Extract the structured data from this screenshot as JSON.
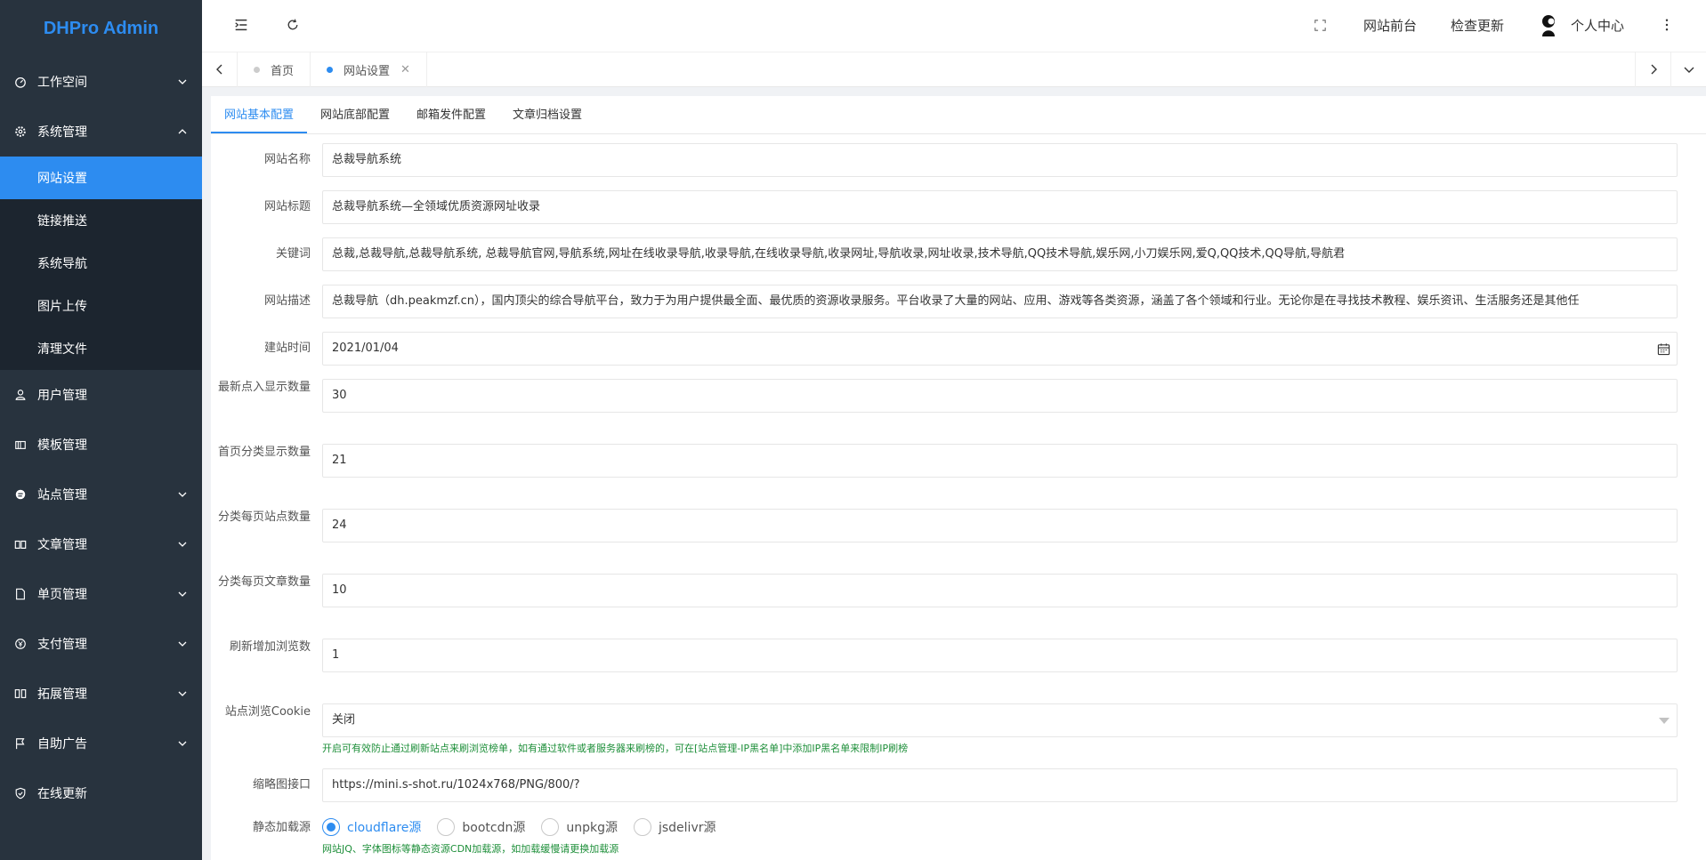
{
  "app": {
    "logo": "DHPro Admin"
  },
  "sidebar": {
    "items": [
      {
        "label": "工作空间",
        "icon": "dashboard-icon",
        "chevron": "down"
      },
      {
        "label": "系统管理",
        "icon": "gear-icon",
        "chevron": "up"
      },
      {
        "label": "用户管理",
        "icon": "user-icon",
        "chevron": ""
      },
      {
        "label": "模板管理",
        "icon": "template-icon",
        "chevron": ""
      },
      {
        "label": "站点管理",
        "icon": "globe-icon",
        "chevron": "down"
      },
      {
        "label": "文章管理",
        "icon": "book-icon",
        "chevron": "down"
      },
      {
        "label": "单页管理",
        "icon": "file-icon",
        "chevron": "down"
      },
      {
        "label": "支付管理",
        "icon": "pay-icon",
        "chevron": "down"
      },
      {
        "label": "拓展管理",
        "icon": "extension-icon",
        "chevron": "down"
      },
      {
        "label": "自助广告",
        "icon": "flag-icon",
        "chevron": "down"
      },
      {
        "label": "在线更新",
        "icon": "shield-check-icon",
        "chevron": ""
      }
    ],
    "system_sub": [
      "网站设置",
      "链接推送",
      "系统导航",
      "图片上传",
      "清理文件"
    ]
  },
  "header": {
    "frontend": "网站前台",
    "check_update": "检查更新",
    "user": "个人中心"
  },
  "tabs": {
    "home": "首页",
    "settings": "网站设置"
  },
  "subtabs": [
    "网站基本配置",
    "网站底部配置",
    "邮箱发件配置",
    "文章归档设置"
  ],
  "form": {
    "site_name": {
      "label": "网站名称",
      "value": "总裁导航系统"
    },
    "site_title": {
      "label": "网站标题",
      "value": "总裁导航系统—全领域优质资源网址收录"
    },
    "keywords": {
      "label": "关键词",
      "value": "总裁,总裁导航,总裁导航系统, 总裁导航官网,导航系统,网址在线收录导航,收录导航,在线收录导航,收录网址,导航收录,网址收录,技术导航,QQ技术导航,娱乐网,小刀娱乐网,爱Q,QQ技术,QQ导航,导航君"
    },
    "description": {
      "label": "网站描述",
      "value": "总裁导航（dh.peakmzf.cn），国内顶尖的综合导航平台，致力于为用户提供最全面、最优质的资源收录服务。平台收录了大量的网站、应用、游戏等各类资源，涵盖了各个领域和行业。无论你是在寻找技术教程、娱乐资讯、生活服务还是其他任"
    },
    "build_date": {
      "label": "建站时间",
      "value": "2021/01/04"
    },
    "latest_count": {
      "label": "最新点入显示数量",
      "value": "30"
    },
    "home_cat_count": {
      "label": "首页分类显示数量",
      "value": "21"
    },
    "cat_site_count": {
      "label": "分类每页站点数量",
      "value": "24"
    },
    "cat_article_count": {
      "label": "分类每页文章数量",
      "value": "10"
    },
    "refresh_views": {
      "label": "刷新增加浏览数",
      "value": "1"
    },
    "site_cookie": {
      "label": "站点浏览Cookie",
      "value": "关闭",
      "hint": "开启可有效防止通过刷新站点来刷浏览榜单，如有通过软件或者服务器来刷榜的，可在[站点管理-IP黑名单]中添加IP黑名单来限制IP刷榜"
    },
    "thumb_api": {
      "label": "缩略图接口",
      "value": "https://mini.s-shot.ru/1024x768/PNG/800/?"
    },
    "static_source": {
      "label": "静态加载源",
      "options": [
        "cloudflare源",
        "bootcdn源",
        "unpkg源",
        "jsdelivr源"
      ],
      "selected": "cloudflare源",
      "hint": "网站JQ、字体图标等静态资源CDN加载源，如加载缓慢请更换加载源"
    }
  }
}
